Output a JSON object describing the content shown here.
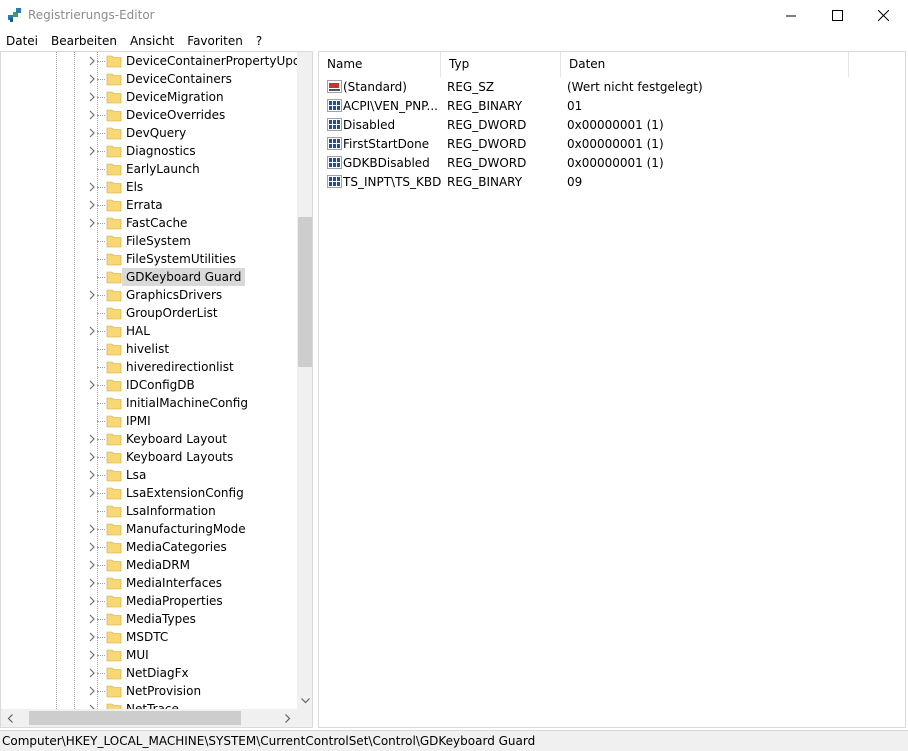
{
  "window": {
    "title": "Registrierungs-Editor",
    "minimize_icon": "minimize-icon",
    "maximize_icon": "maximize-icon",
    "close_icon": "close-icon"
  },
  "menu": [
    "Datei",
    "Bearbeiten",
    "Ansicht",
    "Favoriten",
    "?"
  ],
  "tree": {
    "items": [
      {
        "label": "DeviceContainerPropertyUpdate",
        "expandable": true
      },
      {
        "label": "DeviceContainers",
        "expandable": true
      },
      {
        "label": "DeviceMigration",
        "expandable": true
      },
      {
        "label": "DeviceOverrides",
        "expandable": true
      },
      {
        "label": "DevQuery",
        "expandable": true
      },
      {
        "label": "Diagnostics",
        "expandable": true
      },
      {
        "label": "EarlyLaunch",
        "expandable": false
      },
      {
        "label": "Els",
        "expandable": true
      },
      {
        "label": "Errata",
        "expandable": true
      },
      {
        "label": "FastCache",
        "expandable": true
      },
      {
        "label": "FileSystem",
        "expandable": false
      },
      {
        "label": "FileSystemUtilities",
        "expandable": false
      },
      {
        "label": "GDKeyboard Guard",
        "expandable": false,
        "selected": true
      },
      {
        "label": "GraphicsDrivers",
        "expandable": true
      },
      {
        "label": "GroupOrderList",
        "expandable": false
      },
      {
        "label": "HAL",
        "expandable": true
      },
      {
        "label": "hivelist",
        "expandable": false
      },
      {
        "label": "hiveredirectionlist",
        "expandable": false
      },
      {
        "label": "IDConfigDB",
        "expandable": true
      },
      {
        "label": "InitialMachineConfig",
        "expandable": false
      },
      {
        "label": "IPMI",
        "expandable": false
      },
      {
        "label": "Keyboard Layout",
        "expandable": true
      },
      {
        "label": "Keyboard Layouts",
        "expandable": true
      },
      {
        "label": "Lsa",
        "expandable": true
      },
      {
        "label": "LsaExtensionConfig",
        "expandable": true
      },
      {
        "label": "LsaInformation",
        "expandable": false
      },
      {
        "label": "ManufacturingMode",
        "expandable": true
      },
      {
        "label": "MediaCategories",
        "expandable": true
      },
      {
        "label": "MediaDRM",
        "expandable": true
      },
      {
        "label": "MediaInterfaces",
        "expandable": true
      },
      {
        "label": "MediaProperties",
        "expandable": true
      },
      {
        "label": "MediaTypes",
        "expandable": true
      },
      {
        "label": "MSDTC",
        "expandable": true
      },
      {
        "label": "MUI",
        "expandable": true
      },
      {
        "label": "NetDiagFx",
        "expandable": true
      },
      {
        "label": "NetProvision",
        "expandable": true
      },
      {
        "label": "NetTrace",
        "expandable": true
      }
    ]
  },
  "list": {
    "columns": {
      "name": "Name",
      "type": "Typ",
      "data": "Daten"
    },
    "rows": [
      {
        "icon": "string-value-icon",
        "name": "(Standard)",
        "type": "REG_SZ",
        "data": "(Wert nicht festgelegt)"
      },
      {
        "icon": "binary-value-icon",
        "name": "ACPI\\VEN_PNP...",
        "type": "REG_BINARY",
        "data": "01"
      },
      {
        "icon": "binary-value-icon",
        "name": "Disabled",
        "type": "REG_DWORD",
        "data": "0x00000001 (1)"
      },
      {
        "icon": "binary-value-icon",
        "name": "FirstStartDone",
        "type": "REG_DWORD",
        "data": "0x00000001 (1)"
      },
      {
        "icon": "binary-value-icon",
        "name": "GDKBDisabled",
        "type": "REG_DWORD",
        "data": "0x00000001 (1)"
      },
      {
        "icon": "binary-value-icon",
        "name": "TS_INPT\\TS_KBD",
        "type": "REG_BINARY",
        "data": "09"
      }
    ]
  },
  "statusbar": {
    "path": "Computer\\HKEY_LOCAL_MACHINE\\SYSTEM\\CurrentControlSet\\Control\\GDKeyboard Guard"
  },
  "colors": {
    "folder": "#f8d775",
    "selection": "#d9d9d9",
    "string_icon": "#c0392b",
    "binary_icon": "#1f4fa3"
  }
}
